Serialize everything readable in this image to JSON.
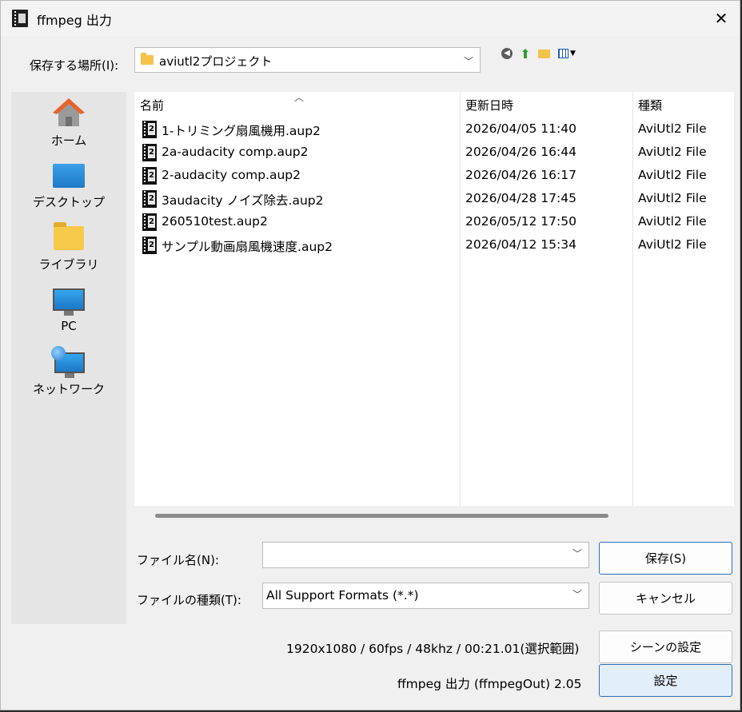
{
  "window": {
    "title": "ffmpeg 出力",
    "close_glyph": "✕"
  },
  "location": {
    "label": "保存する場所(I):",
    "value": "aviutl2プロジェクト"
  },
  "toolbar_icons": [
    "back-icon",
    "up-folder-icon",
    "new-folder-icon",
    "view-menu-icon"
  ],
  "places": [
    {
      "label": "ホーム",
      "icon": "home-icon"
    },
    {
      "label": "デスクトップ",
      "icon": "desktop-icon"
    },
    {
      "label": "ライブラリ",
      "icon": "library-icon"
    },
    {
      "label": "PC",
      "icon": "pc-icon"
    },
    {
      "label": "ネットワーク",
      "icon": "network-icon"
    }
  ],
  "columns": {
    "name": "名前",
    "date": "更新日時",
    "type": "種類"
  },
  "files": [
    {
      "name": "1-トリミング扇風機用.aup2",
      "date": "2026/04/05 11:40",
      "type": "AviUtl2 File"
    },
    {
      "name": "2a-audacity comp.aup2",
      "date": "2026/04/26 16:44",
      "type": "AviUtl2 File"
    },
    {
      "name": "2-audacity comp.aup2",
      "date": "2026/04/26 16:17",
      "type": "AviUtl2 File"
    },
    {
      "name": "3audacity ノイズ除去.aup2",
      "date": "2026/04/28 17:45",
      "type": "AviUtl2 File"
    },
    {
      "name": "260510test.aup2",
      "date": "2026/05/12 17:50",
      "type": "AviUtl2 File"
    },
    {
      "name": "サンプル動画扇風機速度.aup2",
      "date": "2026/04/12 15:34",
      "type": "AviUtl2 File"
    }
  ],
  "filename": {
    "label": "ファイル名(N):",
    "value": ""
  },
  "filetype": {
    "label": "ファイルの種類(T):",
    "value": "All Support Formats (*.*)"
  },
  "buttons": {
    "save": "保存(S)",
    "cancel": "キャンセル",
    "scene_settings": "シーンの設定",
    "settings": "設定"
  },
  "info": {
    "scene": "1920x1080 / 60fps / 48khz / 00:21.01(選択範囲)",
    "plugin": "ffmpeg 出力 (ffmpegOut) 2.05"
  }
}
